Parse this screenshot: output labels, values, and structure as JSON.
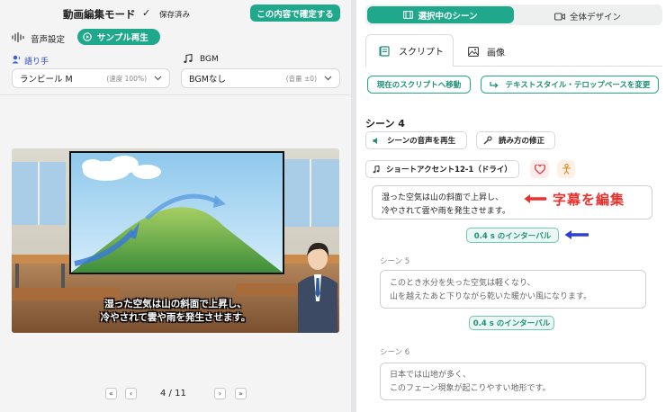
{
  "header": {
    "mode_title": "動画編集モード",
    "saved_check": "✓",
    "saved_label": "保存済み",
    "confirm_button": "この内容で確定する"
  },
  "audio": {
    "settings_label": "音声設定",
    "sample_play_label": "サンプル再生",
    "narrator_label": "語り手",
    "narrator_value": "ランビール M",
    "narrator_speed": "(速度 100%)",
    "bgm_label": "BGM",
    "bgm_value": "BGMなし",
    "bgm_volume": "(音量 ±0)"
  },
  "video": {
    "subtitle_line1": "湿った空気は山の斜面で上昇し、",
    "subtitle_line2": "冷やされて雲や雨を発生させます。"
  },
  "pager": {
    "current": "4 / 11"
  },
  "tabs": {
    "selected_scene": "選択中のシーン",
    "overall_design": "全体デザイン"
  },
  "subtabs": {
    "script": "スクリプト",
    "image": "画像"
  },
  "actions": {
    "go_to_current": "現在のスクリプトへ移動",
    "change_style": "テキストスタイル・テロップベースを変更"
  },
  "scene4": {
    "title": "シーン 4",
    "play_audio": "シーンの音声を再生",
    "fix_reading": "読み方の修正",
    "accent": "ショートアクセント12-1（ドライ）",
    "text_line1": "湿った空気は山の斜面で上昇し、",
    "text_line2": "冷やされて雲や雨を発生させます。",
    "annotation": "字幕を編集",
    "interval": "0.4 s のインターバル"
  },
  "scene5": {
    "title": "シーン 5",
    "text_line1": "このとき水分を失った空気は軽くなり、",
    "text_line2": "山を越えたあと下りながら乾いた暖かい風になります。",
    "interval": "0.4 s のインターバル"
  },
  "scene6": {
    "title": "シーン 6",
    "text_line1": "日本では山地が多く、",
    "text_line2": "このフェーン現象が起こりやすい地形です。"
  },
  "colors": {
    "accent": "#1fa88c",
    "annotation_red": "#e8322e",
    "arrow_blue": "#2d3fd6"
  },
  "icons": {
    "waveform": "waveform-icon",
    "play_circle": "play-circle-icon",
    "speaker_person": "speaker-person-icon",
    "music_note": "music-note-icon",
    "chevron_down": "chevron-down-icon",
    "film": "film-icon",
    "video_camera": "video-camera-icon",
    "script": "script-icon",
    "image": "image-icon",
    "redirect_arrow": "redirect-arrow-icon",
    "volume": "volume-icon",
    "wrench": "wrench-icon",
    "heart": "heart-icon",
    "person": "person-icon"
  }
}
